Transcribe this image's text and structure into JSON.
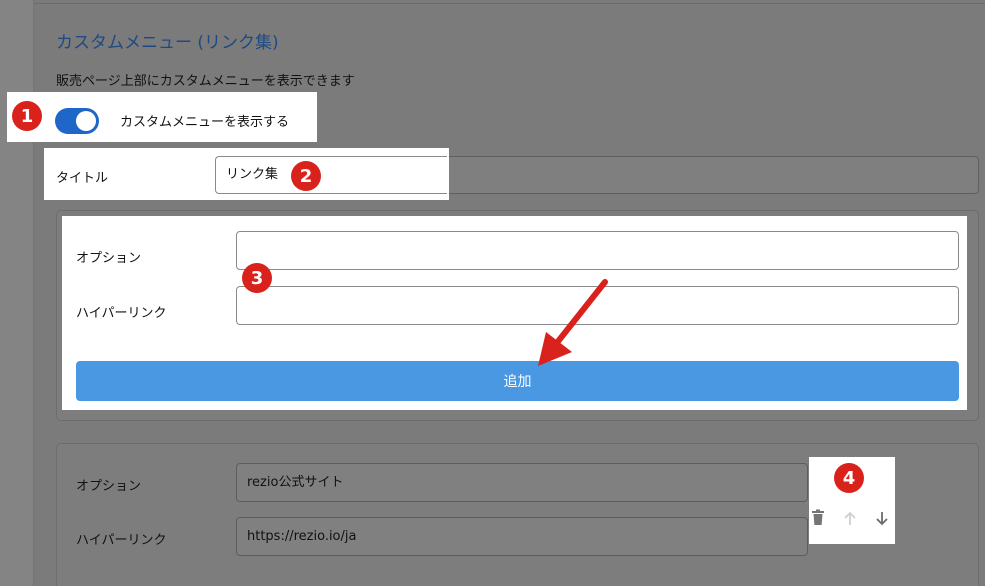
{
  "section": {
    "title": "カスタムメニュー (リンク集)",
    "description": "販売ページ上部にカスタムメニューを表示できます"
  },
  "toggle": {
    "label": "カスタムメニューを表示する",
    "checked": true
  },
  "title_field": {
    "label": "タイトル",
    "value": "リンク集"
  },
  "new_item": {
    "option_label": "オプション",
    "option_value": "",
    "link_label": "ハイパーリンク",
    "link_value": "",
    "add_label": "追加"
  },
  "existing_item": {
    "option_label": "オプション",
    "option_value": "rezio公式サイト",
    "link_label": "ハイパーリンク",
    "link_value": "https://rezio.io/ja"
  },
  "markers": [
    "1",
    "2",
    "3",
    "4"
  ],
  "colors": {
    "toggle": "#1e66c8",
    "add_button": "#4a97e2",
    "marker": "#d9221b",
    "title": "#1d4a82"
  },
  "icons": [
    "delete-icon",
    "arrow-up-icon",
    "arrow-down-icon",
    "pointer-arrow-icon"
  ]
}
